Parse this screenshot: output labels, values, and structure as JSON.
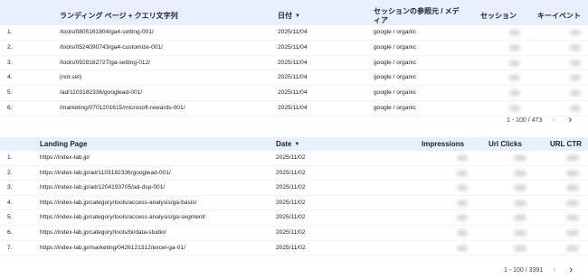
{
  "table1": {
    "headers": {
      "landing": "ランディング ページ + クエリ文字列",
      "date": "日付",
      "source": "セッションの参照元 / メディア",
      "sessions": "セッション",
      "key_events": "キーイベント"
    },
    "rows": [
      {
        "n": "1.",
        "page": "/tools/0805161804/ga4-setting-001/",
        "date": "2025/11/04",
        "source": "google / organic"
      },
      {
        "n": "2.",
        "page": "/tools/0524090743/ga4-customize-001/",
        "date": "2025/11/04",
        "source": "google / organic"
      },
      {
        "n": "3.",
        "page": "/tools/0928182727/ga-setting-012/",
        "date": "2025/11/04",
        "source": "google / organic"
      },
      {
        "n": "4.",
        "page": "(not set)",
        "date": "2025/11/04",
        "source": "google / organic"
      },
      {
        "n": "5.",
        "page": "/ad/1103182336/googlead-001/",
        "date": "2025/11/04",
        "source": "google / organic"
      },
      {
        "n": "6.",
        "page": "/marketing/0701201615/microsoft-rewards-001/",
        "date": "2025/11/04",
        "source": "google / organic"
      }
    ],
    "pagination": "1 - 100 / 473"
  },
  "table2": {
    "headers": {
      "landing": "Landing Page",
      "date": "Date",
      "impressions": "Impressions",
      "url_clicks": "Url Clicks",
      "url_ctr": "URL CTR"
    },
    "rows": [
      {
        "n": "1.",
        "page": "https://index-lab.jp/",
        "date": "2025/11/02"
      },
      {
        "n": "2.",
        "page": "https://index-lab.jp/ad/1103182336/googlead-001/",
        "date": "2025/11/02"
      },
      {
        "n": "3.",
        "page": "https://index-lab.jp/ad/1204193705/ad-dsp-001/",
        "date": "2025/11/02"
      },
      {
        "n": "4.",
        "page": "https://index-lab.jp/category/tools/access-analysis/ga-basis/",
        "date": "2025/11/02"
      },
      {
        "n": "5.",
        "page": "https://index-lab.jp/category/tools/access-analysis/ga-segment/",
        "date": "2025/11/02"
      },
      {
        "n": "6.",
        "page": "https://index-lab.jp/category/tools/bi/data-studio/",
        "date": "2025/11/02"
      },
      {
        "n": "7.",
        "page": "https://index-lab.jp/marketing/0426121312/excel-ga-01/",
        "date": "2025/11/02"
      }
    ],
    "pagination": "1 - 100 / 3391"
  },
  "icons": {
    "sort": "sort-descending-icon",
    "prev": "chevron-left-icon",
    "next": "chevron-right-icon"
  }
}
